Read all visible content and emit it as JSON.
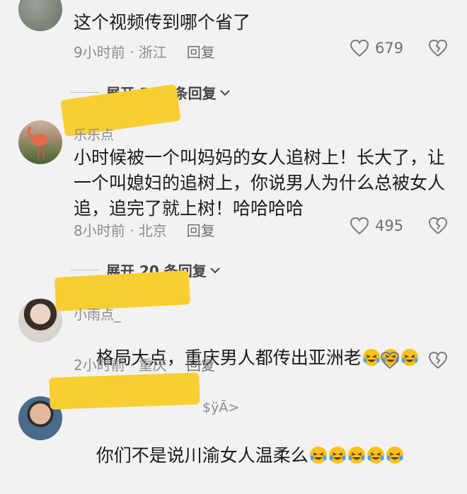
{
  "comments": [
    {
      "text": "这个视频传到哪个省了",
      "time": "9小时前 · 浙江",
      "reply": "回复",
      "likes": "679",
      "expand": "展开 321 条回复"
    },
    {
      "username": "乐乐点",
      "text": "小时候被一个叫妈妈的女人追树上！长大了，让一个叫媳妇的追树上，你说男人为什么总被女人追，追完了就上树！哈哈哈哈",
      "time": "8小时前 · 北京",
      "reply": "回复",
      "likes": "495",
      "expand": "展开 20 条回复"
    },
    {
      "username": "小雨点_",
      "text": "格局大点，重庆男人都传出亚洲老",
      "emoji_count": 3,
      "time": "2小时前 · 重庆",
      "reply": "回复"
    },
    {
      "username": "$ÿĀ>",
      "text": "你们不是说川渝女人温柔么",
      "emoji_count": 5
    }
  ],
  "colors": {
    "background": "#f2f2f2",
    "redaction": "#f8cf33",
    "meta": "#8c8c8c"
  }
}
